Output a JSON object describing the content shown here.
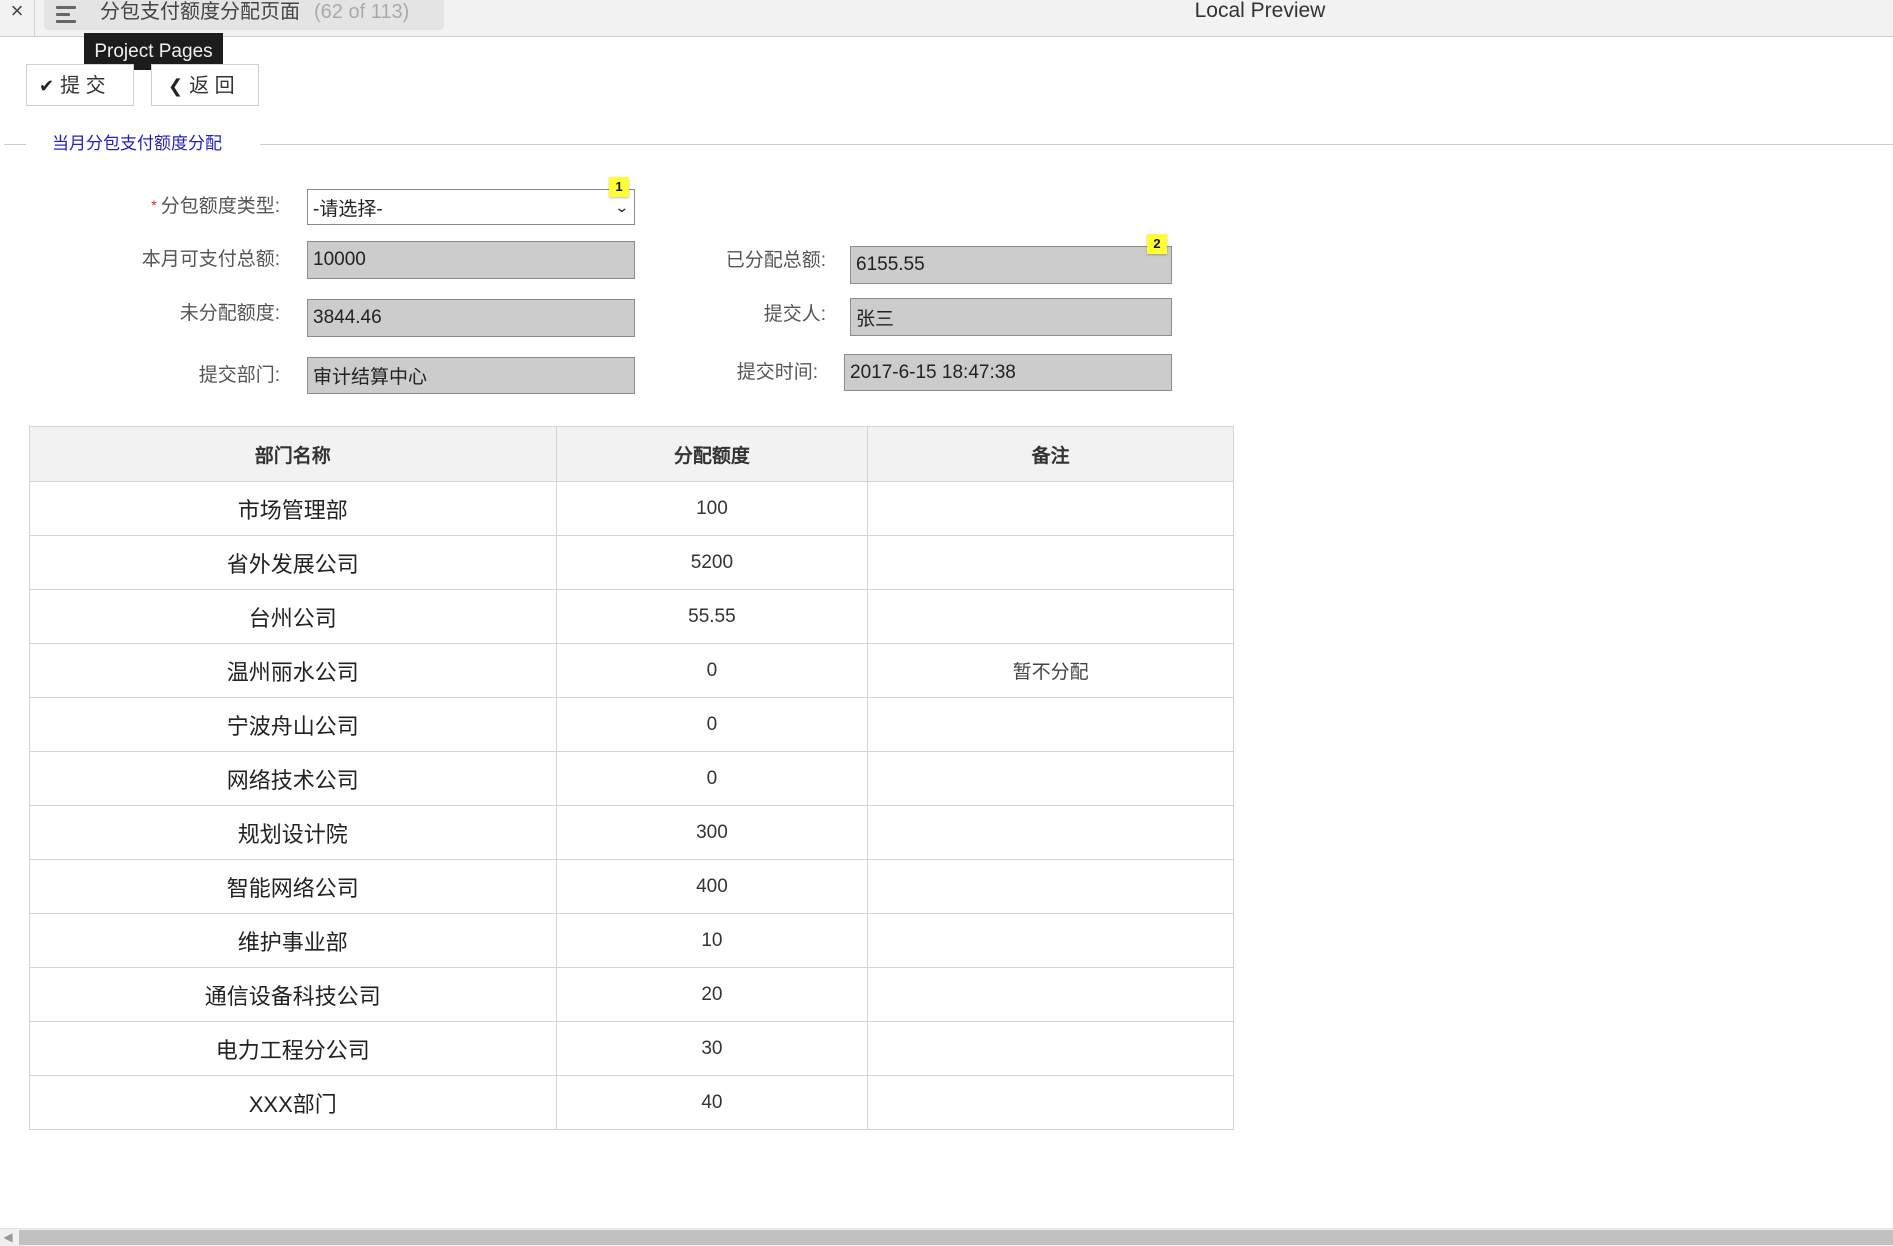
{
  "topbar": {
    "close_icon": "close-icon",
    "menu_icon": "hamburger-menu-icon",
    "page_title": "分包支付额度分配页面",
    "page_count": "(62 of 113)",
    "preview_label": "Local Preview"
  },
  "tooltip": {
    "text": "Project Pages"
  },
  "toolbar": {
    "submit_icon": "✔",
    "submit_label": "提 交",
    "back_icon": "❮",
    "back_label": "返 回"
  },
  "section": {
    "legend": "当月分包支付额度分配"
  },
  "form": {
    "required_mark": "*",
    "quota_type": {
      "label": "分包额度类型:",
      "value": "-请选择-",
      "badge": "1"
    },
    "monthly_total": {
      "label": "本月可支付总额:",
      "value": "10000"
    },
    "allocated_total": {
      "label": "已分配总额:",
      "value": "6155.55",
      "badge": "2"
    },
    "unallocated": {
      "label": "未分配额度:",
      "value": "3844.46"
    },
    "submitter": {
      "label": "提交人:",
      "value": "张三"
    },
    "department": {
      "label": "提交部门:",
      "value": "审计结算中心"
    },
    "submit_time": {
      "label": "提交时间:",
      "value": "2017-6-15 18:47:38"
    }
  },
  "table": {
    "headers": [
      "部门名称",
      "分配额度",
      "备注"
    ],
    "rows": [
      {
        "dept": "市场管理部",
        "amount": "100",
        "note": ""
      },
      {
        "dept": "省外发展公司",
        "amount": "5200",
        "note": ""
      },
      {
        "dept": "台州公司",
        "amount": "55.55",
        "note": ""
      },
      {
        "dept": "温州丽水公司",
        "amount": "0",
        "note": "暂不分配"
      },
      {
        "dept": "宁波舟山公司",
        "amount": "0",
        "note": ""
      },
      {
        "dept": "网络技术公司",
        "amount": "0",
        "note": ""
      },
      {
        "dept": "规划设计院",
        "amount": "300",
        "note": ""
      },
      {
        "dept": "智能网络公司",
        "amount": "400",
        "note": ""
      },
      {
        "dept": "维护事业部",
        "amount": "10",
        "note": ""
      },
      {
        "dept": "通信设备科技公司",
        "amount": "20",
        "note": ""
      },
      {
        "dept": "电力工程分公司",
        "amount": "30",
        "note": ""
      },
      {
        "dept": "XXX部门",
        "amount": "40",
        "note": ""
      }
    ]
  },
  "scrollbar": {
    "left_arrow": "◀"
  }
}
